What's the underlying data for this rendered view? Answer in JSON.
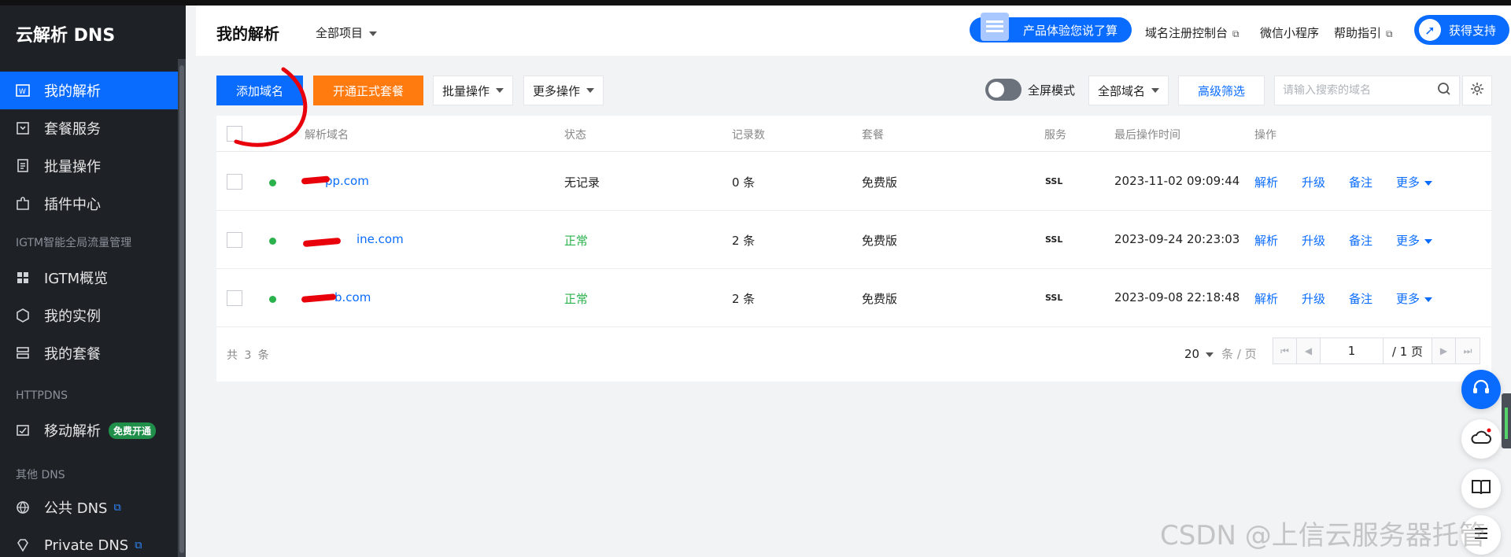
{
  "sidebar": {
    "brand": "云解析 DNS",
    "items_main": [
      {
        "label": "我的解析",
        "icon": "dns-record-icon"
      },
      {
        "label": "套餐服务",
        "icon": "package-icon"
      },
      {
        "label": "批量操作",
        "icon": "batch-icon"
      },
      {
        "label": "插件中心",
        "icon": "plugin-icon"
      }
    ],
    "group_igtm": "IGTM智能全局流量管理",
    "items_igtm": [
      {
        "label": "IGTM概览",
        "icon": "grid-icon"
      },
      {
        "label": "我的实例",
        "icon": "instance-icon"
      },
      {
        "label": "我的套餐",
        "icon": "stack-icon"
      }
    ],
    "group_httpdns": "HTTPDNS",
    "item_mobile": {
      "label": "移动解析",
      "badge": "免费开通"
    },
    "group_other": "其他 DNS",
    "item_public": "公共 DNS",
    "item_private": "Private DNS"
  },
  "header": {
    "title": "我的解析",
    "project_select": "全部项目",
    "promo": "产品体验您说了算",
    "link_register": "域名注册控制台",
    "link_wechat": "微信小程序",
    "link_help": "帮助指引",
    "support": "获得支持"
  },
  "toolbar": {
    "add_domain": "添加域名",
    "open_package": "开通正式套餐",
    "batch": "批量操作",
    "more": "更多操作",
    "fullscreen": "全屏模式",
    "domain_filter": "全部域名",
    "advanced_filter": "高级筛选",
    "search_placeholder": "请输入搜索的域名"
  },
  "table": {
    "columns": [
      "解析域名",
      "状态",
      "记录数",
      "套餐",
      "服务",
      "最后操作时间",
      "操作"
    ],
    "rows": [
      {
        "domain": "pp.com",
        "status": "无记录",
        "records": "0 条",
        "plan": "免费版",
        "service": "SSL",
        "time": "2023-11-02 09:09:44"
      },
      {
        "domain": "ine.com",
        "status": "正常",
        "records": "2 条",
        "plan": "免费版",
        "service": "SSL",
        "time": "2023-09-24 20:23:03"
      },
      {
        "domain": "b.com",
        "status": "正常",
        "records": "2 条",
        "plan": "免费版",
        "service": "SSL",
        "time": "2023-09-08 22:18:48"
      }
    ],
    "actions": {
      "resolve": "解析",
      "upgrade": "升级",
      "note": "备注",
      "more": "更多"
    }
  },
  "pagination": {
    "total": "共 3 条",
    "page_size": "20",
    "page_size_unit": "条 / 页",
    "current_page": "1",
    "total_pages": "/ 1 页"
  },
  "watermark": "CSDN @上信云服务器托管",
  "colors": {
    "primary": "#0a6cff",
    "orange": "#ff7a0f",
    "success": "#2bb24c",
    "sidebar": "#1e2126"
  }
}
